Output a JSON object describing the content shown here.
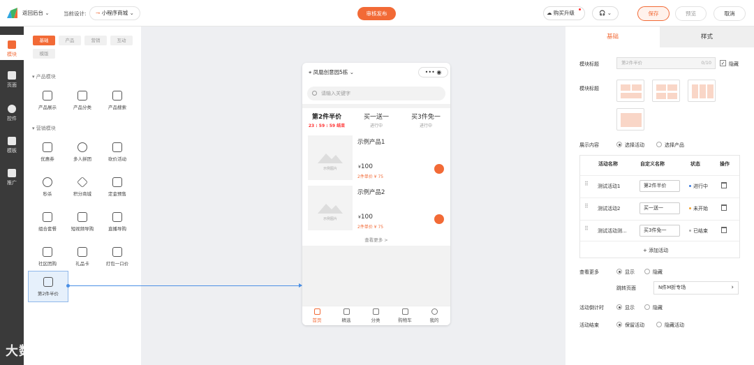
{
  "topbar": {
    "back": "返回后台",
    "back_arrow": "⌄",
    "current_label": "当前设计:",
    "current_value": "小程序商城",
    "publish": "审核发布",
    "upgrade": "购买升级",
    "save": "保存",
    "preview": "预览",
    "cancel": "取消"
  },
  "leftnav": [
    {
      "label": "模块",
      "icon": "module-icon"
    },
    {
      "label": "页面",
      "icon": "page-icon"
    },
    {
      "label": "控件",
      "icon": "widget-icon"
    },
    {
      "label": "模板",
      "icon": "template-icon"
    },
    {
      "label": "推广",
      "icon": "promo-icon"
    }
  ],
  "panel": {
    "tabs": [
      "基础",
      "产品",
      "营销",
      "互动",
      "模版"
    ],
    "section_product": "产品模块",
    "section_marketing": "营销模块",
    "modules": [
      {
        "label": "产品展示",
        "icon": "grid-icon"
      },
      {
        "label": "产品分类",
        "icon": "list-icon"
      },
      {
        "label": "产品搜索",
        "icon": "search-grid-icon"
      },
      {
        "label": "优惠券",
        "icon": "coupon-icon"
      },
      {
        "label": "多人拼团",
        "icon": "group-icon"
      },
      {
        "label": "砍价活动",
        "icon": "tag-icon"
      },
      {
        "label": "秒杀",
        "icon": "timer-icon"
      },
      {
        "label": "积分商城",
        "icon": "points-icon"
      },
      {
        "label": "定金预售",
        "icon": "presale-icon"
      },
      {
        "label": "组合套餐",
        "icon": "combo-icon"
      },
      {
        "label": "短视频导购",
        "icon": "video-bag-icon"
      },
      {
        "label": "直播导购",
        "icon": "live-icon"
      },
      {
        "label": "社区团购",
        "icon": "community-icon"
      },
      {
        "label": "礼品卡",
        "icon": "giftcard-icon"
      },
      {
        "label": "打包一口价",
        "icon": "package-icon"
      },
      {
        "label": "第2件半价",
        "icon": "percent-icon"
      }
    ]
  },
  "phone": {
    "location": "凤凰创意园5栋",
    "capsule_dots": "•••",
    "capsule_target": "◉",
    "search_placeholder": "请输入关键字",
    "activities": [
      {
        "name": "第2件半价",
        "status": "23 : 59 : 59 结束"
      },
      {
        "name": "买一送一",
        "status": "进行中"
      },
      {
        "name": "买3件免一",
        "status": "进行中"
      }
    ],
    "products": [
      {
        "name": "示例产品1",
        "price_symbol": "¥",
        "price": "100",
        "sub": "2件单价 ¥ 75",
        "img_caption": "示例图片"
      },
      {
        "name": "示例产品2",
        "price_symbol": "¥",
        "price": "100",
        "sub": "2件单价 ¥ 75",
        "img_caption": "示例图片"
      }
    ],
    "more": "查看更多 >",
    "tabbar": [
      {
        "label": "首页",
        "icon": "home-icon"
      },
      {
        "label": "精选",
        "icon": "gift-icon"
      },
      {
        "label": "分类",
        "icon": "category-icon"
      },
      {
        "label": "购物车",
        "icon": "cart-icon"
      },
      {
        "label": "我的",
        "icon": "user-icon"
      }
    ]
  },
  "right": {
    "tabs": [
      "基础",
      "样式"
    ],
    "module_title_label": "模块标题",
    "module_title_value": "第2件半价",
    "module_title_count": "0/10",
    "hide_label": "隐藏",
    "hide_check": "✓",
    "module_style_label": "模块标题",
    "display_label": "展示内容",
    "display_opt1": "选择活动",
    "display_opt2": "选择产品",
    "table_headers": [
      "活动名称",
      "自定义名称",
      "状态",
      "操作"
    ],
    "rows": [
      {
        "name": "测试活动1",
        "custom": "第2件半价",
        "status": "进行中",
        "status_color": "#3a7be0"
      },
      {
        "name": "测试活动2",
        "custom": "买一送一",
        "status": "未开始",
        "status_color": "#f2a12e"
      },
      {
        "name": "测试活动测...",
        "custom": "买3件免一",
        "status": "已结束",
        "status_color": "#aaaaaa"
      }
    ],
    "drag_glyph": "⠿",
    "add_activity": "+ 添加活动",
    "view_more_label": "查看更多",
    "show": "显示",
    "hide": "隐藏",
    "jump_label": "跳转页面",
    "jump_value": "N件M折专场",
    "jump_chevron": "›",
    "countdown_label": "活动倒计时",
    "end_label": "活动结束",
    "end_opt1": "保留活动",
    "end_opt2": "隐藏活动"
  },
  "watermark": "大数跨境",
  "colors": {
    "accent": "#f26a36",
    "link": "#4a8fe5"
  }
}
